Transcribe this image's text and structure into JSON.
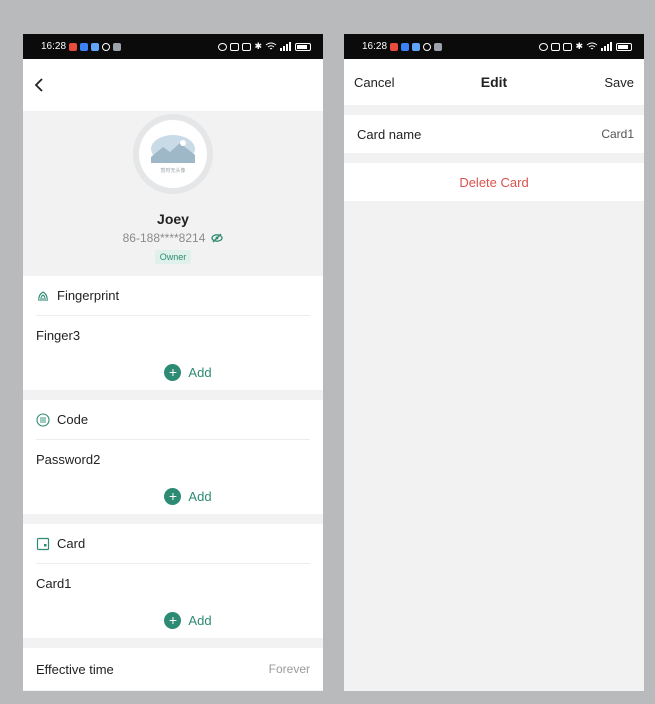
{
  "status_bar": {
    "time": "16:28"
  },
  "left_screen": {
    "profile": {
      "avatar_caption": "暂时无头像",
      "name": "Joey",
      "phone": "86-188****8214",
      "role_badge": "Owner"
    },
    "sections": [
      {
        "title": "Fingerprint",
        "icon": "fingerprint-icon",
        "item": "Finger3",
        "add_label": "Add"
      },
      {
        "title": "Code",
        "icon": "keypad-icon",
        "item": "Password2",
        "add_label": "Add"
      },
      {
        "title": "Card",
        "icon": "card-icon",
        "item": "Card1",
        "add_label": "Add"
      }
    ],
    "effective_time": {
      "label": "Effective time",
      "value": "Forever"
    }
  },
  "right_screen": {
    "nav": {
      "cancel": "Cancel",
      "title": "Edit",
      "save": "Save"
    },
    "card_name": {
      "label": "Card name",
      "value": "Card1"
    },
    "delete_label": "Delete Card"
  },
  "colors": {
    "accent": "#2e8b73",
    "danger": "#d9534f",
    "background": "#f2f2f2"
  }
}
